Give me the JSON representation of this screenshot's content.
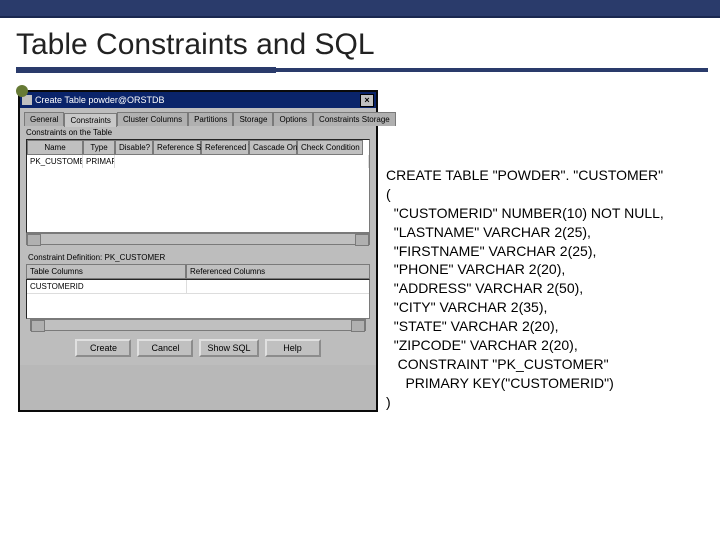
{
  "slide": {
    "title": "Table Constraints and SQL"
  },
  "dialog": {
    "title": "Create Table  powder@ORSTDB",
    "tabs": [
      "General",
      "Constraints",
      "Cluster Columns",
      "Partitions",
      "Storage",
      "Options",
      "Constraints Storage"
    ],
    "active_tab": 1,
    "group_label": "Constraints on the Table",
    "columns": [
      "Name",
      "Type",
      "Disable?",
      "Reference Schema",
      "Referenced Table",
      "Cascade On Delete",
      "Check Condition"
    ],
    "row1": {
      "name": "PK_CUSTOMER",
      "type": "PRIMARY"
    },
    "subgroup_title": "Constraint Definition:  PK_CUSTOMER",
    "sub_columns": [
      "Table Columns",
      "Referenced Columns"
    ],
    "sub_row1": {
      "col": "CUSTOMERID"
    },
    "buttons": {
      "create": "Create",
      "cancel": "Cancel",
      "showsql": "Show SQL",
      "help": "Help"
    }
  },
  "sql": {
    "l0": "CREATE TABLE \"POWDER\". \"CUSTOMER\"",
    "l1": "(",
    "l2": "  \"CUSTOMERID\" NUMBER(10) NOT NULL,",
    "l3": "  \"LASTNAME\" VARCHAR 2(25),",
    "l4": "  \"FIRSTNAME\" VARCHAR 2(25),",
    "l5": "  \"PHONE\" VARCHAR 2(20),",
    "l6": "  \"ADDRESS\" VARCHAR 2(50),",
    "l7": "  \"CITY\" VARCHAR 2(35),",
    "l8": "  \"STATE\" VARCHAR 2(20),",
    "l9": "  \"ZIPCODE\" VARCHAR 2(20),",
    "l10": "   CONSTRAINT \"PK_CUSTOMER\"",
    "l11": "     PRIMARY KEY(\"CUSTOMERID\")",
    "l12": ")"
  }
}
